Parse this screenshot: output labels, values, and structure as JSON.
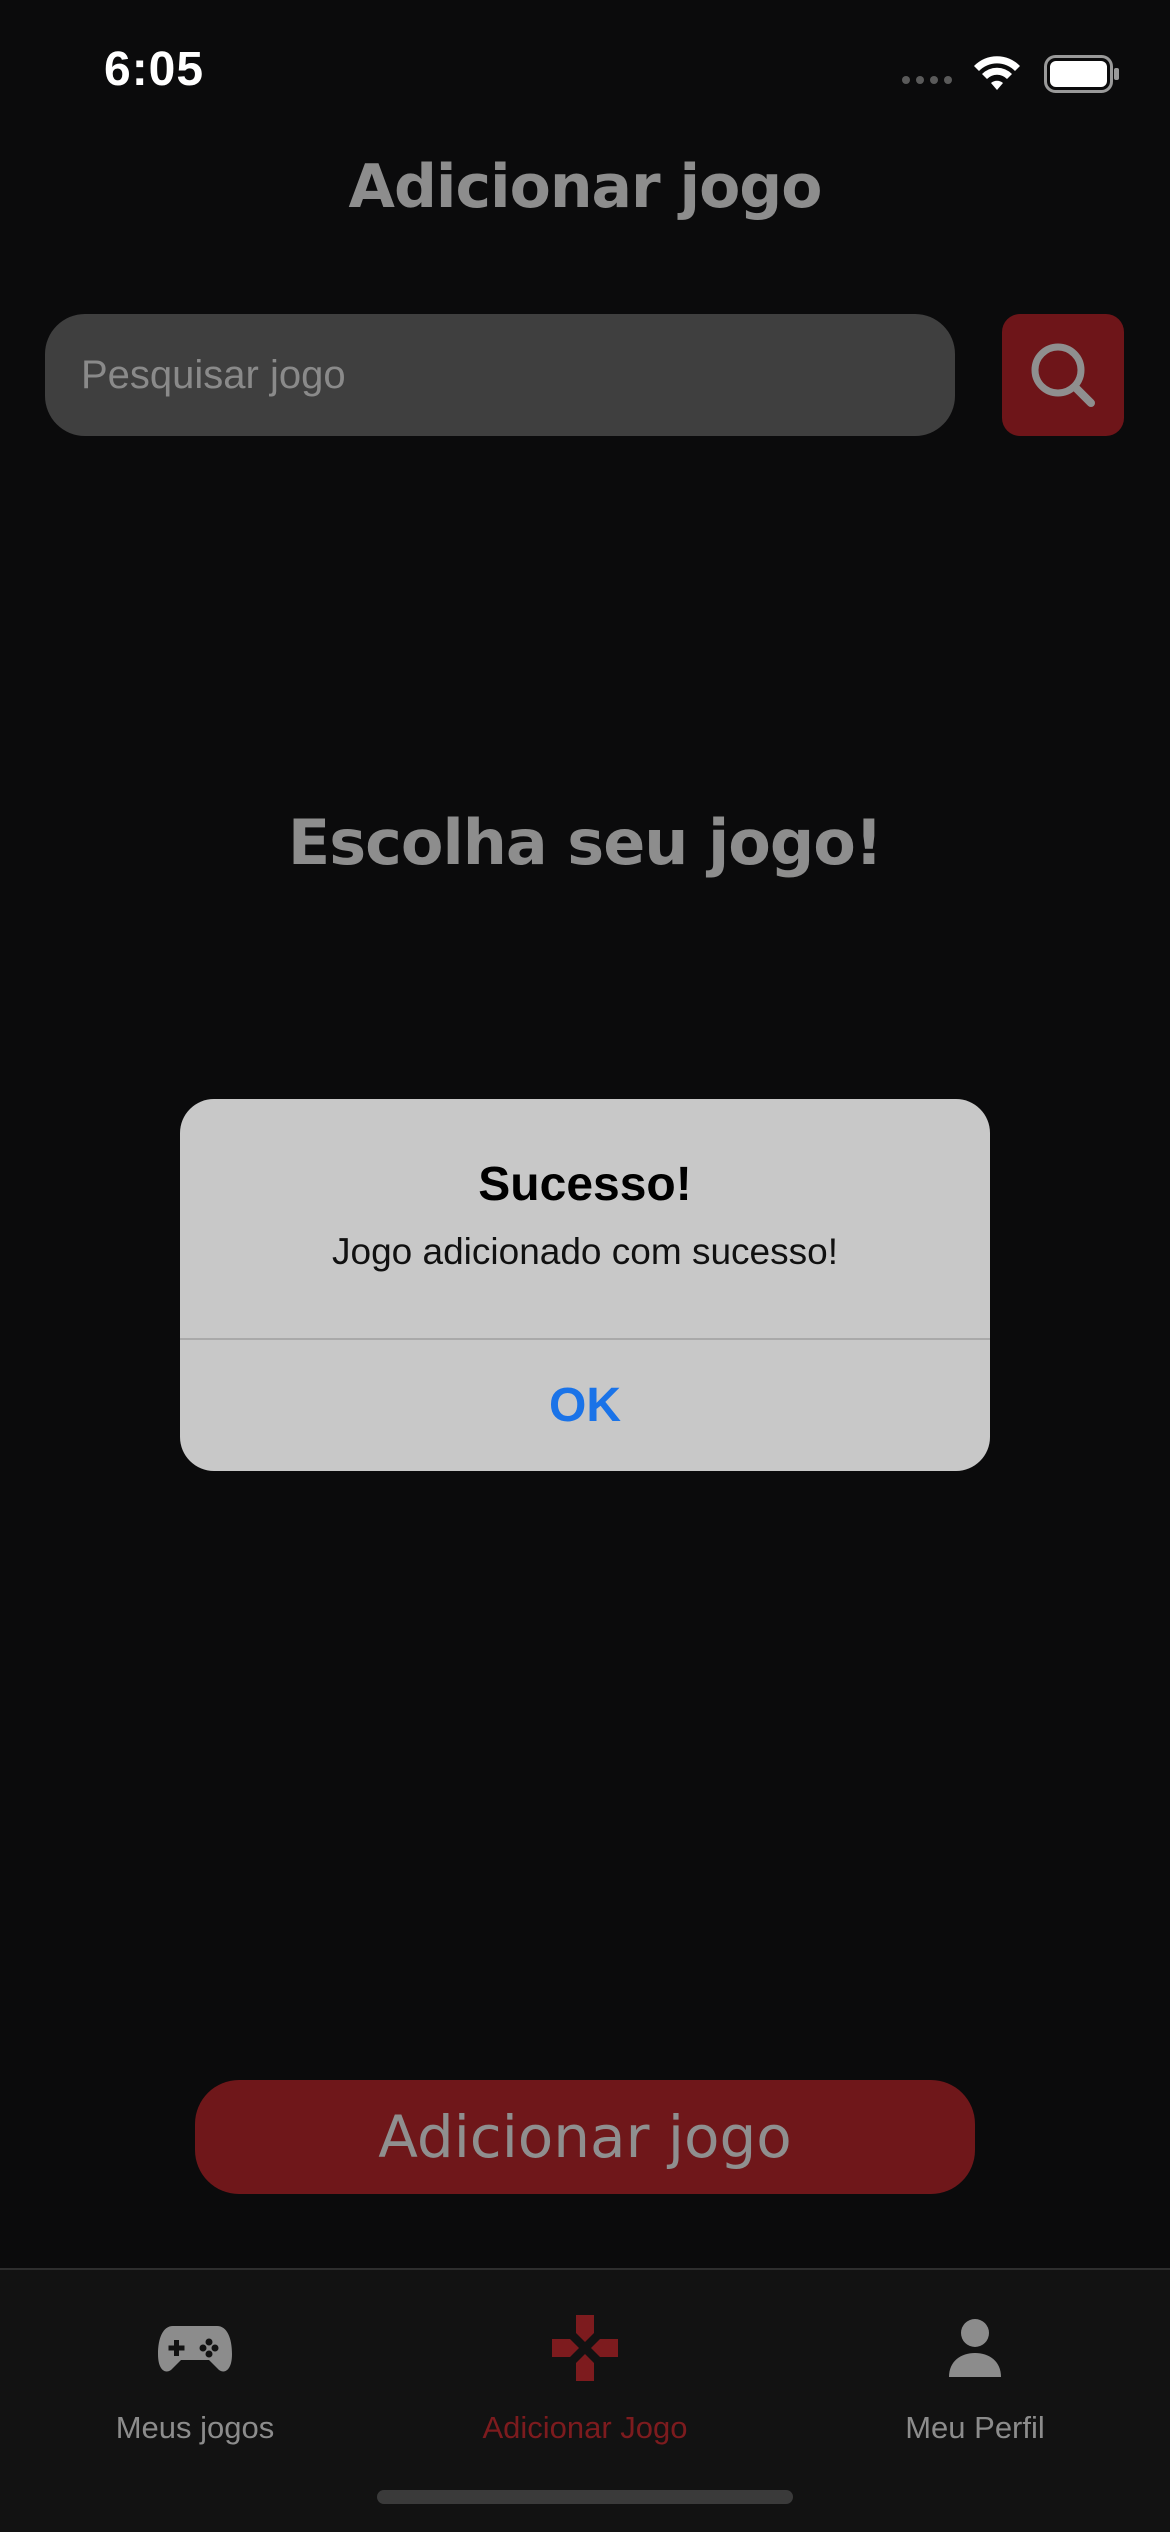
{
  "status_bar": {
    "time": "6:05"
  },
  "header": {
    "title": "Adicionar jogo"
  },
  "search": {
    "placeholder": "Pesquisar jogo",
    "value": ""
  },
  "empty_state": {
    "title": "Escolha seu jogo!"
  },
  "primary_action": {
    "label": "Adicionar jogo"
  },
  "tabs": [
    {
      "label": "Meus jogos",
      "icon": "gamepad-icon",
      "active": false
    },
    {
      "label": "Adicionar Jogo",
      "icon": "dpad-cross-icon",
      "active": true
    },
    {
      "label": "Meu Perfil",
      "icon": "user-icon",
      "active": false
    }
  ],
  "alert": {
    "title": "Sucesso!",
    "message": "Jogo adicionado com sucesso!",
    "ok_label": "OK"
  },
  "colors": {
    "background": "#0b0b0c",
    "accent_red": "#6e1519",
    "muted_text": "#8d8d8d",
    "alert_bg": "#c8c8c8",
    "alert_button": "#1a73e8"
  }
}
